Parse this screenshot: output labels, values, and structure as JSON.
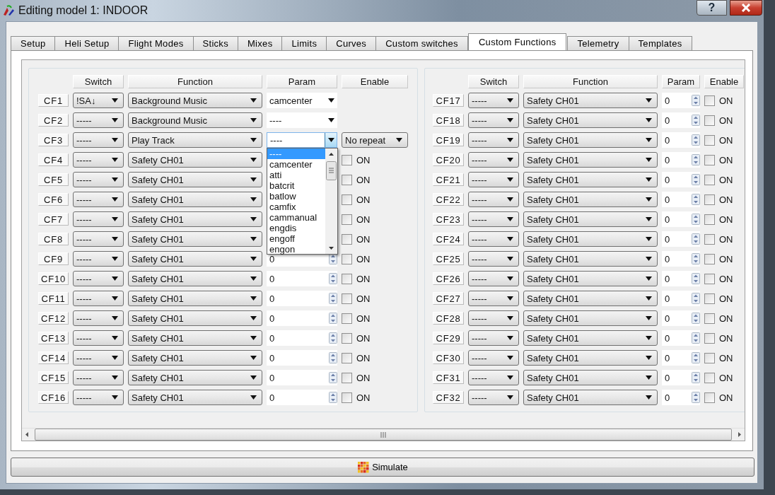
{
  "window": {
    "title": "Editing model 1: INDOOR",
    "help": "?"
  },
  "tabs": [
    {
      "label": "Setup",
      "selected": false
    },
    {
      "label": "Heli Setup",
      "selected": false
    },
    {
      "label": "Flight Modes",
      "selected": false
    },
    {
      "label": "Sticks",
      "selected": false
    },
    {
      "label": "Mixes",
      "selected": false
    },
    {
      "label": "Limits",
      "selected": false
    },
    {
      "label": "Curves",
      "selected": false
    },
    {
      "label": "Custom switches",
      "selected": false
    },
    {
      "label": "Custom Functions",
      "selected": true
    },
    {
      "label": "Telemetry",
      "selected": false
    },
    {
      "label": "Templates",
      "selected": false
    }
  ],
  "groups": [
    {
      "headers": [
        "Switch",
        "Function",
        "Param",
        "Enable"
      ],
      "rows": [
        {
          "label": "CF1",
          "switch": "!SA↓",
          "function": "Background Music",
          "param": {
            "kind": "combo",
            "value": "camcenter",
            "open": false
          }
        },
        {
          "label": "CF2",
          "switch": "-----",
          "function": "Background Music",
          "param": {
            "kind": "combo",
            "value": "----",
            "open": false
          }
        },
        {
          "label": "CF3",
          "switch": "-----",
          "function": "Play Track",
          "param": {
            "kind": "combo",
            "value": "----",
            "open": true,
            "options": [
              {
                "label": "----",
                "selected": true
              },
              {
                "label": "camcenter",
                "selected": false
              },
              {
                "label": "atti",
                "selected": false
              },
              {
                "label": "batcrit",
                "selected": false
              },
              {
                "label": "batlow",
                "selected": false
              },
              {
                "label": "camfix",
                "selected": false
              },
              {
                "label": "cammanual",
                "selected": false
              },
              {
                "label": "engdis",
                "selected": false
              },
              {
                "label": "engoff",
                "selected": false
              },
              {
                "label": "engon",
                "selected": false
              }
            ]
          },
          "enable": {
            "kind": "combo",
            "value": "No repeat"
          }
        },
        {
          "label": "CF4",
          "switch": "-----",
          "function": "Safety CH01",
          "enable": {
            "kind": "checkbox",
            "label": "ON",
            "checked": false
          }
        },
        {
          "label": "CF5",
          "switch": "-----",
          "function": "Safety CH01",
          "enable": {
            "kind": "checkbox",
            "label": "ON",
            "checked": false
          }
        },
        {
          "label": "CF6",
          "switch": "-----",
          "function": "Safety CH01",
          "enable": {
            "kind": "checkbox",
            "label": "ON",
            "checked": false
          }
        },
        {
          "label": "CF7",
          "switch": "-----",
          "function": "Safety CH01",
          "enable": {
            "kind": "checkbox",
            "label": "ON",
            "checked": false
          }
        },
        {
          "label": "CF8",
          "switch": "-----",
          "function": "Safety CH01",
          "enable": {
            "kind": "checkbox",
            "label": "ON",
            "checked": false
          }
        },
        {
          "label": "CF9",
          "switch": "-----",
          "function": "Safety CH01",
          "param": {
            "kind": "spin",
            "value": "0"
          },
          "enable": {
            "kind": "checkbox",
            "label": "ON",
            "checked": false
          }
        },
        {
          "label": "CF10",
          "switch": "-----",
          "function": "Safety CH01",
          "param": {
            "kind": "spin",
            "value": "0"
          },
          "enable": {
            "kind": "checkbox",
            "label": "ON",
            "checked": false
          }
        },
        {
          "label": "CF11",
          "switch": "-----",
          "function": "Safety CH01",
          "param": {
            "kind": "spin",
            "value": "0"
          },
          "enable": {
            "kind": "checkbox",
            "label": "ON",
            "checked": false
          }
        },
        {
          "label": "CF12",
          "switch": "-----",
          "function": "Safety CH01",
          "param": {
            "kind": "spin",
            "value": "0"
          },
          "enable": {
            "kind": "checkbox",
            "label": "ON",
            "checked": false
          }
        },
        {
          "label": "CF13",
          "switch": "-----",
          "function": "Safety CH01",
          "param": {
            "kind": "spin",
            "value": "0"
          },
          "enable": {
            "kind": "checkbox",
            "label": "ON",
            "checked": false
          }
        },
        {
          "label": "CF14",
          "switch": "-----",
          "function": "Safety CH01",
          "param": {
            "kind": "spin",
            "value": "0"
          },
          "enable": {
            "kind": "checkbox",
            "label": "ON",
            "checked": false
          }
        },
        {
          "label": "CF15",
          "switch": "-----",
          "function": "Safety CH01",
          "param": {
            "kind": "spin",
            "value": "0"
          },
          "enable": {
            "kind": "checkbox",
            "label": "ON",
            "checked": false
          }
        },
        {
          "label": "CF16",
          "switch": "-----",
          "function": "Safety CH01",
          "param": {
            "kind": "spin",
            "value": "0"
          },
          "enable": {
            "kind": "checkbox",
            "label": "ON",
            "checked": false
          }
        }
      ]
    },
    {
      "headers": [
        "Switch",
        "Function",
        "Param",
        "Enable"
      ],
      "rows": [
        {
          "label": "CF17",
          "switch": "-----",
          "function": "Safety CH01",
          "param": {
            "kind": "spin",
            "value": "0"
          },
          "enable": {
            "kind": "checkbox",
            "label": "ON",
            "checked": false
          }
        },
        {
          "label": "CF18",
          "switch": "-----",
          "function": "Safety CH01",
          "param": {
            "kind": "spin",
            "value": "0"
          },
          "enable": {
            "kind": "checkbox",
            "label": "ON",
            "checked": false
          }
        },
        {
          "label": "CF19",
          "switch": "-----",
          "function": "Safety CH01",
          "param": {
            "kind": "spin",
            "value": "0"
          },
          "enable": {
            "kind": "checkbox",
            "label": "ON",
            "checked": false
          }
        },
        {
          "label": "CF20",
          "switch": "-----",
          "function": "Safety CH01",
          "param": {
            "kind": "spin",
            "value": "0"
          },
          "enable": {
            "kind": "checkbox",
            "label": "ON",
            "checked": false
          }
        },
        {
          "label": "CF21",
          "switch": "-----",
          "function": "Safety CH01",
          "param": {
            "kind": "spin",
            "value": "0"
          },
          "enable": {
            "kind": "checkbox",
            "label": "ON",
            "checked": false
          }
        },
        {
          "label": "CF22",
          "switch": "-----",
          "function": "Safety CH01",
          "param": {
            "kind": "spin",
            "value": "0"
          },
          "enable": {
            "kind": "checkbox",
            "label": "ON",
            "checked": false
          }
        },
        {
          "label": "CF23",
          "switch": "-----",
          "function": "Safety CH01",
          "param": {
            "kind": "spin",
            "value": "0"
          },
          "enable": {
            "kind": "checkbox",
            "label": "ON",
            "checked": false
          }
        },
        {
          "label": "CF24",
          "switch": "-----",
          "function": "Safety CH01",
          "param": {
            "kind": "spin",
            "value": "0"
          },
          "enable": {
            "kind": "checkbox",
            "label": "ON",
            "checked": false
          }
        },
        {
          "label": "CF25",
          "switch": "-----",
          "function": "Safety CH01",
          "param": {
            "kind": "spin",
            "value": "0"
          },
          "enable": {
            "kind": "checkbox",
            "label": "ON",
            "checked": false
          }
        },
        {
          "label": "CF26",
          "switch": "-----",
          "function": "Safety CH01",
          "param": {
            "kind": "spin",
            "value": "0"
          },
          "enable": {
            "kind": "checkbox",
            "label": "ON",
            "checked": false
          }
        },
        {
          "label": "CF27",
          "switch": "-----",
          "function": "Safety CH01",
          "param": {
            "kind": "spin",
            "value": "0"
          },
          "enable": {
            "kind": "checkbox",
            "label": "ON",
            "checked": false
          }
        },
        {
          "label": "CF28",
          "switch": "-----",
          "function": "Safety CH01",
          "param": {
            "kind": "spin",
            "value": "0"
          },
          "enable": {
            "kind": "checkbox",
            "label": "ON",
            "checked": false
          }
        },
        {
          "label": "CF29",
          "switch": "-----",
          "function": "Safety CH01",
          "param": {
            "kind": "spin",
            "value": "0"
          },
          "enable": {
            "kind": "checkbox",
            "label": "ON",
            "checked": false
          }
        },
        {
          "label": "CF30",
          "switch": "-----",
          "function": "Safety CH01",
          "param": {
            "kind": "spin",
            "value": "0"
          },
          "enable": {
            "kind": "checkbox",
            "label": "ON",
            "checked": false
          }
        },
        {
          "label": "CF31",
          "switch": "-----",
          "function": "Safety CH01",
          "param": {
            "kind": "spin",
            "value": "0"
          },
          "enable": {
            "kind": "checkbox",
            "label": "ON",
            "checked": false
          }
        },
        {
          "label": "CF32",
          "switch": "-----",
          "function": "Safety CH01",
          "param": {
            "kind": "spin",
            "value": "0"
          },
          "enable": {
            "kind": "checkbox",
            "label": "ON",
            "checked": false
          }
        }
      ]
    }
  ],
  "simulate": {
    "label": "Simulate"
  }
}
